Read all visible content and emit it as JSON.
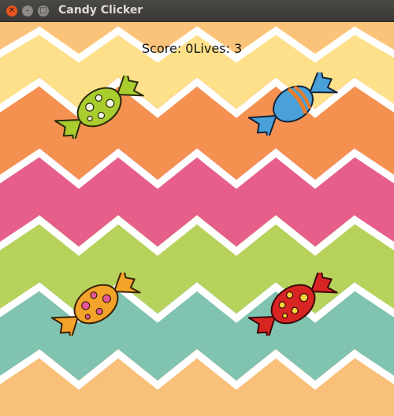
{
  "window": {
    "title": "Candy Clicker",
    "controls": [
      "close",
      "minimize",
      "maximize"
    ]
  },
  "hud": {
    "score_label": "Score: ",
    "score": "0",
    "lives_label": "Lives: ",
    "lives": "3"
  },
  "background": {
    "stripe_colors": [
      "#fbc27a",
      "#fde089",
      "#f59150",
      "#e65f8a",
      "#b6d25b",
      "#7fc3b0",
      "#f9c07a"
    ],
    "zigzag_line_color": "#ffffff"
  },
  "candies": [
    {
      "color": "lime",
      "pattern": "white spots"
    },
    {
      "color": "blue",
      "pattern": "orange band"
    },
    {
      "color": "orange",
      "pattern": "pink spots"
    },
    {
      "color": "red",
      "pattern": "yellow spots"
    }
  ]
}
